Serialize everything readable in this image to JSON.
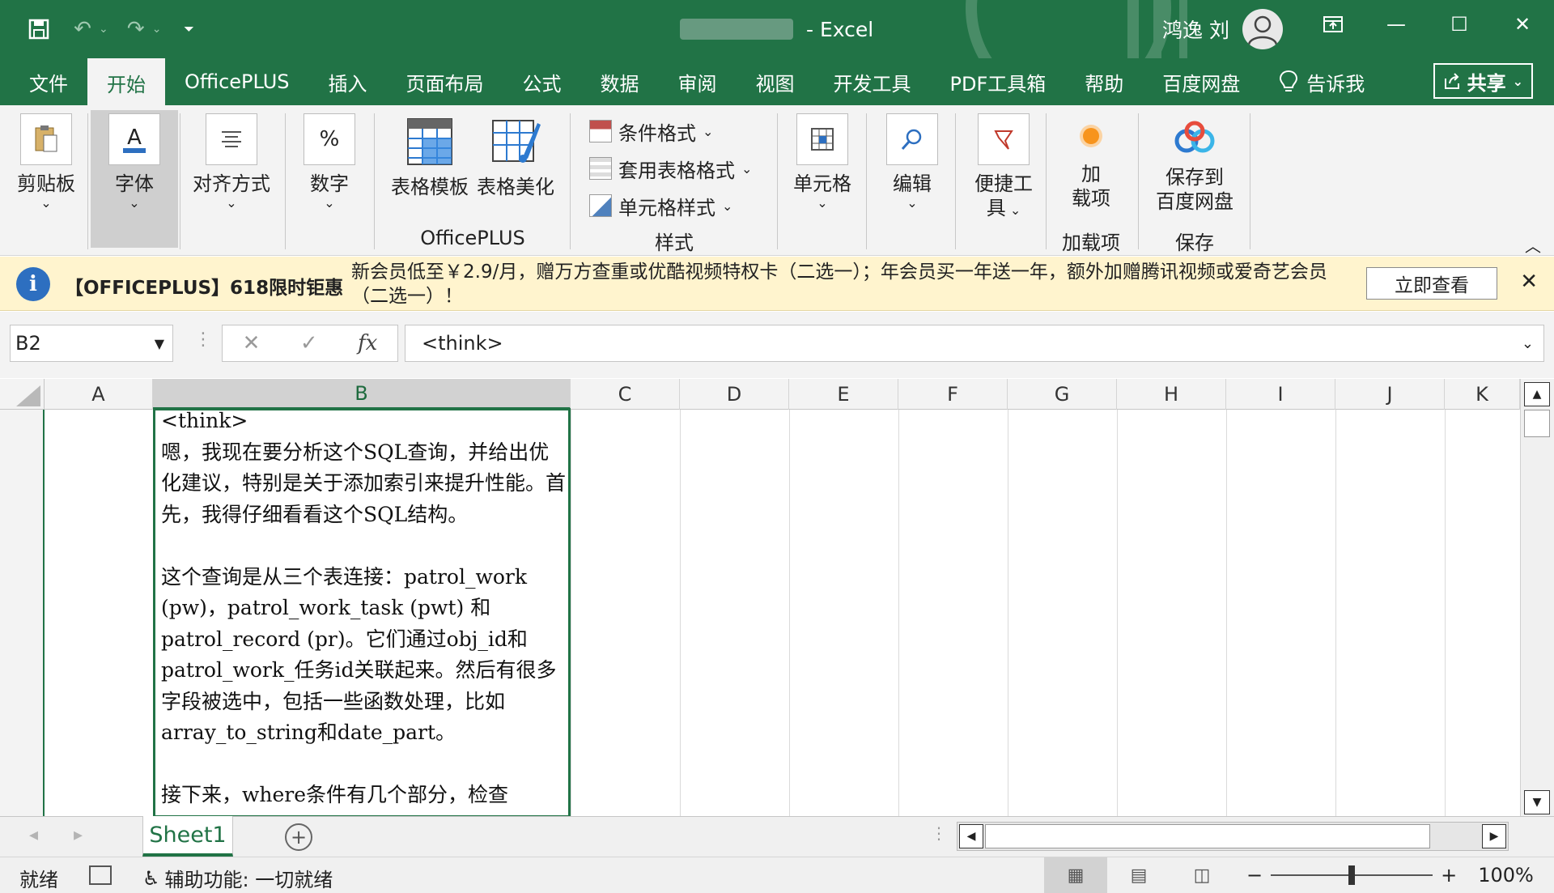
{
  "window": {
    "title": "Excel",
    "user_name": "鸿逸 刘"
  },
  "tabs": [
    "文件",
    "开始",
    "OfficePLUS",
    "插入",
    "页面布局",
    "公式",
    "数据",
    "审阅",
    "视图",
    "开发工具",
    "PDF工具箱",
    "帮助",
    "百度网盘",
    "告诉我"
  ],
  "share_label": "共享",
  "ribbon": {
    "clipboard": "剪贴板",
    "font": "字体",
    "align": "对齐方式",
    "number": "数字",
    "table_template": "表格模板",
    "table_beautify": "表格美化",
    "group_officeplus": "OfficePLUS",
    "cond_format": "条件格式",
    "table_format": "套用表格格式",
    "cell_style": "单元格样式",
    "group_style": "样式",
    "cells": "单元格",
    "editing": "编辑",
    "quick_tools_1": "便捷工",
    "quick_tools_2": "具",
    "addin_1": "加",
    "addin_2": "载项",
    "group_addin": "加载项",
    "save_baidu_1": "保存到",
    "save_baidu_2": "百度网盘",
    "group_save": "保存"
  },
  "notice": {
    "title": "【OFFICEPLUS】618限时钜惠",
    "message": "新会员低至￥2.9/月，赠万方查重或优酷视频特权卡（二选一）；年会员买一年送一年，额外加赠腾讯视频或爱奇艺会员（二选一）！",
    "button": "立即查看"
  },
  "formula_bar": {
    "name_box": "B2",
    "fx": "fx",
    "content": "<think>"
  },
  "columns": [
    "A",
    "B",
    "C",
    "D",
    "E",
    "F",
    "G",
    "H",
    "I",
    "J",
    "K"
  ],
  "selected_column": "B",
  "cell_b2_text": "<think>\n嗯，我现在要分析这个SQL查询，并给出优化建议，特别是关于添加索引来提升性能。首先，我得仔细看看这个SQL结构。\n\n这个查询是从三个表连接：patrol_work (pw)，patrol_work_task (pwt) 和 patrol_record (pr)。它们通过obj_id和patrol_work_任务id关联起来。然后有很多字段被选中，包括一些函数处理，比如array_to_string和date_part。\n\n接下来，where条件有几个部分，检查",
  "sheet_tab": "Sheet1",
  "status": {
    "ready": "就绪",
    "accessibility": "辅助功能: 一切就绪",
    "zoom": "100%"
  },
  "colors": {
    "excel_green": "#217346",
    "notice_bg": "#fff4ce"
  }
}
